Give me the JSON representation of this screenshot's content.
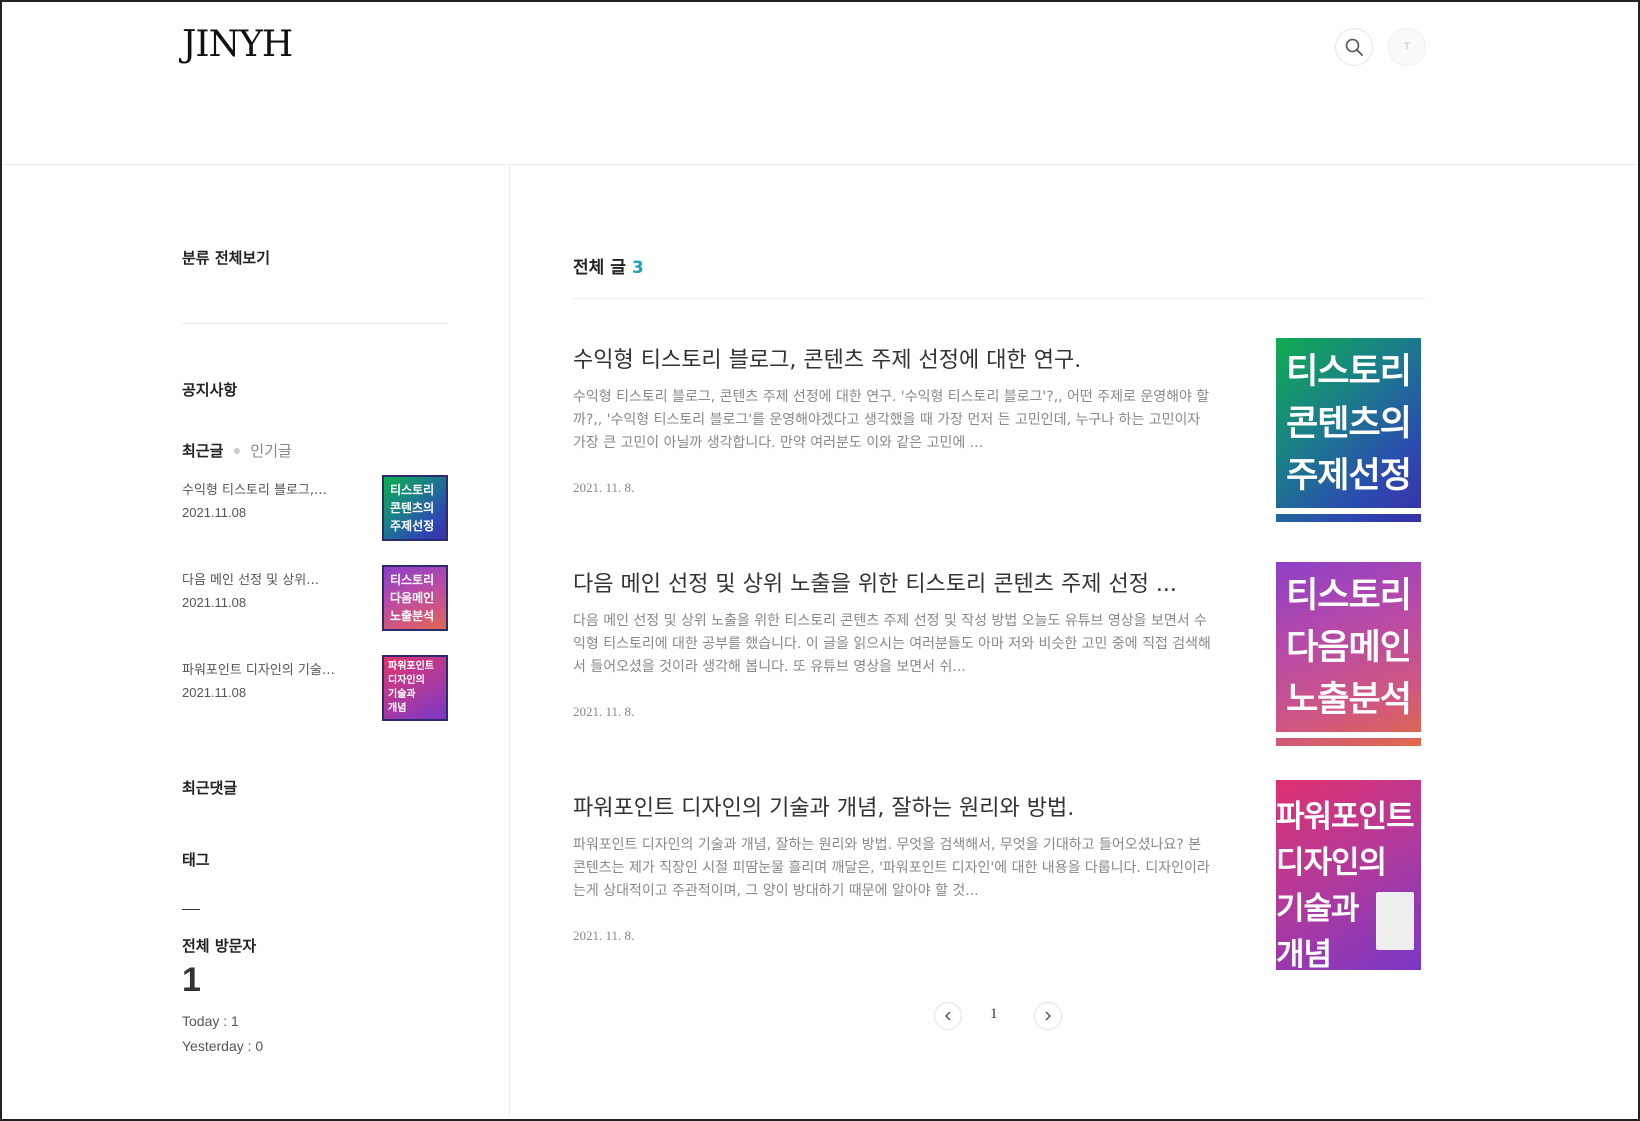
{
  "header": {
    "logo": "JINYH",
    "search_icon": "search-icon",
    "profile_initial": "T"
  },
  "sidebar": {
    "category_all": "분류 전체보기",
    "notice": "공지사항",
    "tabs": {
      "recent": "최근글",
      "popular": "인기글"
    },
    "recent_posts": [
      {
        "title": "수익형 티스토리 블로그,…",
        "date": "2021.11.08",
        "thumb": [
          "티스토리",
          "콘텐츠의",
          "주제선정"
        ]
      },
      {
        "title": "다음 메인 선정 및 상위…",
        "date": "2021.11.08",
        "thumb": [
          "티스토리",
          "다음메인",
          "노출분석"
        ]
      },
      {
        "title": "파워포인트 디자인의 기술…",
        "date": "2021.11.08",
        "thumb": [
          "파워포인트",
          "디자인의",
          "기술과",
          "개념"
        ]
      }
    ],
    "recent_comments": "최근댓글",
    "tags": "태그",
    "visitors": {
      "label": "전체 방문자",
      "total": "1",
      "today": "Today : 1",
      "yesterday": "Yesterday : 0"
    }
  },
  "main": {
    "heading": "전체 글",
    "count": "3",
    "posts": [
      {
        "title": "수익형 티스토리 블로그, 콘텐츠 주제 선정에 대한 연구.",
        "excerpt": "수익형 티스토리 블로그, 콘텐츠 주제 선정에 대한 연구. '수익형 티스토리 블로그'?,, 어떤 주제로 운영해야 할까?,, '수익형 티스토리 블로그'를 운영해야겠다고 생각했을 때 가장 먼저 든 고민인데, 누구나 하는 고민이자 가장 큰 고민이 아닐까 생각합니다. 만약 여러분도 이와 같은 고민에 ...",
        "date": "2021. 11. 8.",
        "thumb": [
          "티스토리",
          "콘텐츠의",
          "주제선정"
        ]
      },
      {
        "title": "다음 메인 선정 및 상위 노출을 위한 티스토리 콘텐츠 주제 선정 ...",
        "excerpt": "다음 메인 선정 및 상위 노출을 위한 티스토리 콘텐츠 주제 선정 및 작성 방법 오늘도 유튜브 영상을 보면서 수익형 티스토리에 대한 공부를 했습니다. 이 글을 읽으시는 여러분들도 아마 저와 비슷한 고민 중에 직접 검색해서 들어오셨을 것이라 생각해 봅니다. 또 유튜브 영상을 보면서 쉬...",
        "date": "2021. 11. 8.",
        "thumb": [
          "티스토리",
          "다음메인",
          "노출분석"
        ]
      },
      {
        "title": "파워포인트 디자인의 기술과 개념, 잘하는 원리와 방법.",
        "excerpt": "파워포인트 디자인의 기술과 개념, 잘하는 원리와 방법. 무엇을 검색해서, 무엇을 기대하고 들어오셨나요? 본 콘텐츠는 제가 직장인 시절 피땀눈물 흘리며 깨달은, '파워포인트 디자인'에 대한 내용을 다룹니다. 디자인이라는게 상대적이고 주관적이며, 그 양이 방대하기 때문에 알아야 할 것...",
        "date": "2021. 11. 8.",
        "thumb": [
          "파워포인트",
          "디자인의",
          "기술과",
          "개념"
        ]
      }
    ]
  },
  "pagination": {
    "current": "1",
    "prev_icon": "chevron-left-icon",
    "next_icon": "chevron-right-icon"
  }
}
